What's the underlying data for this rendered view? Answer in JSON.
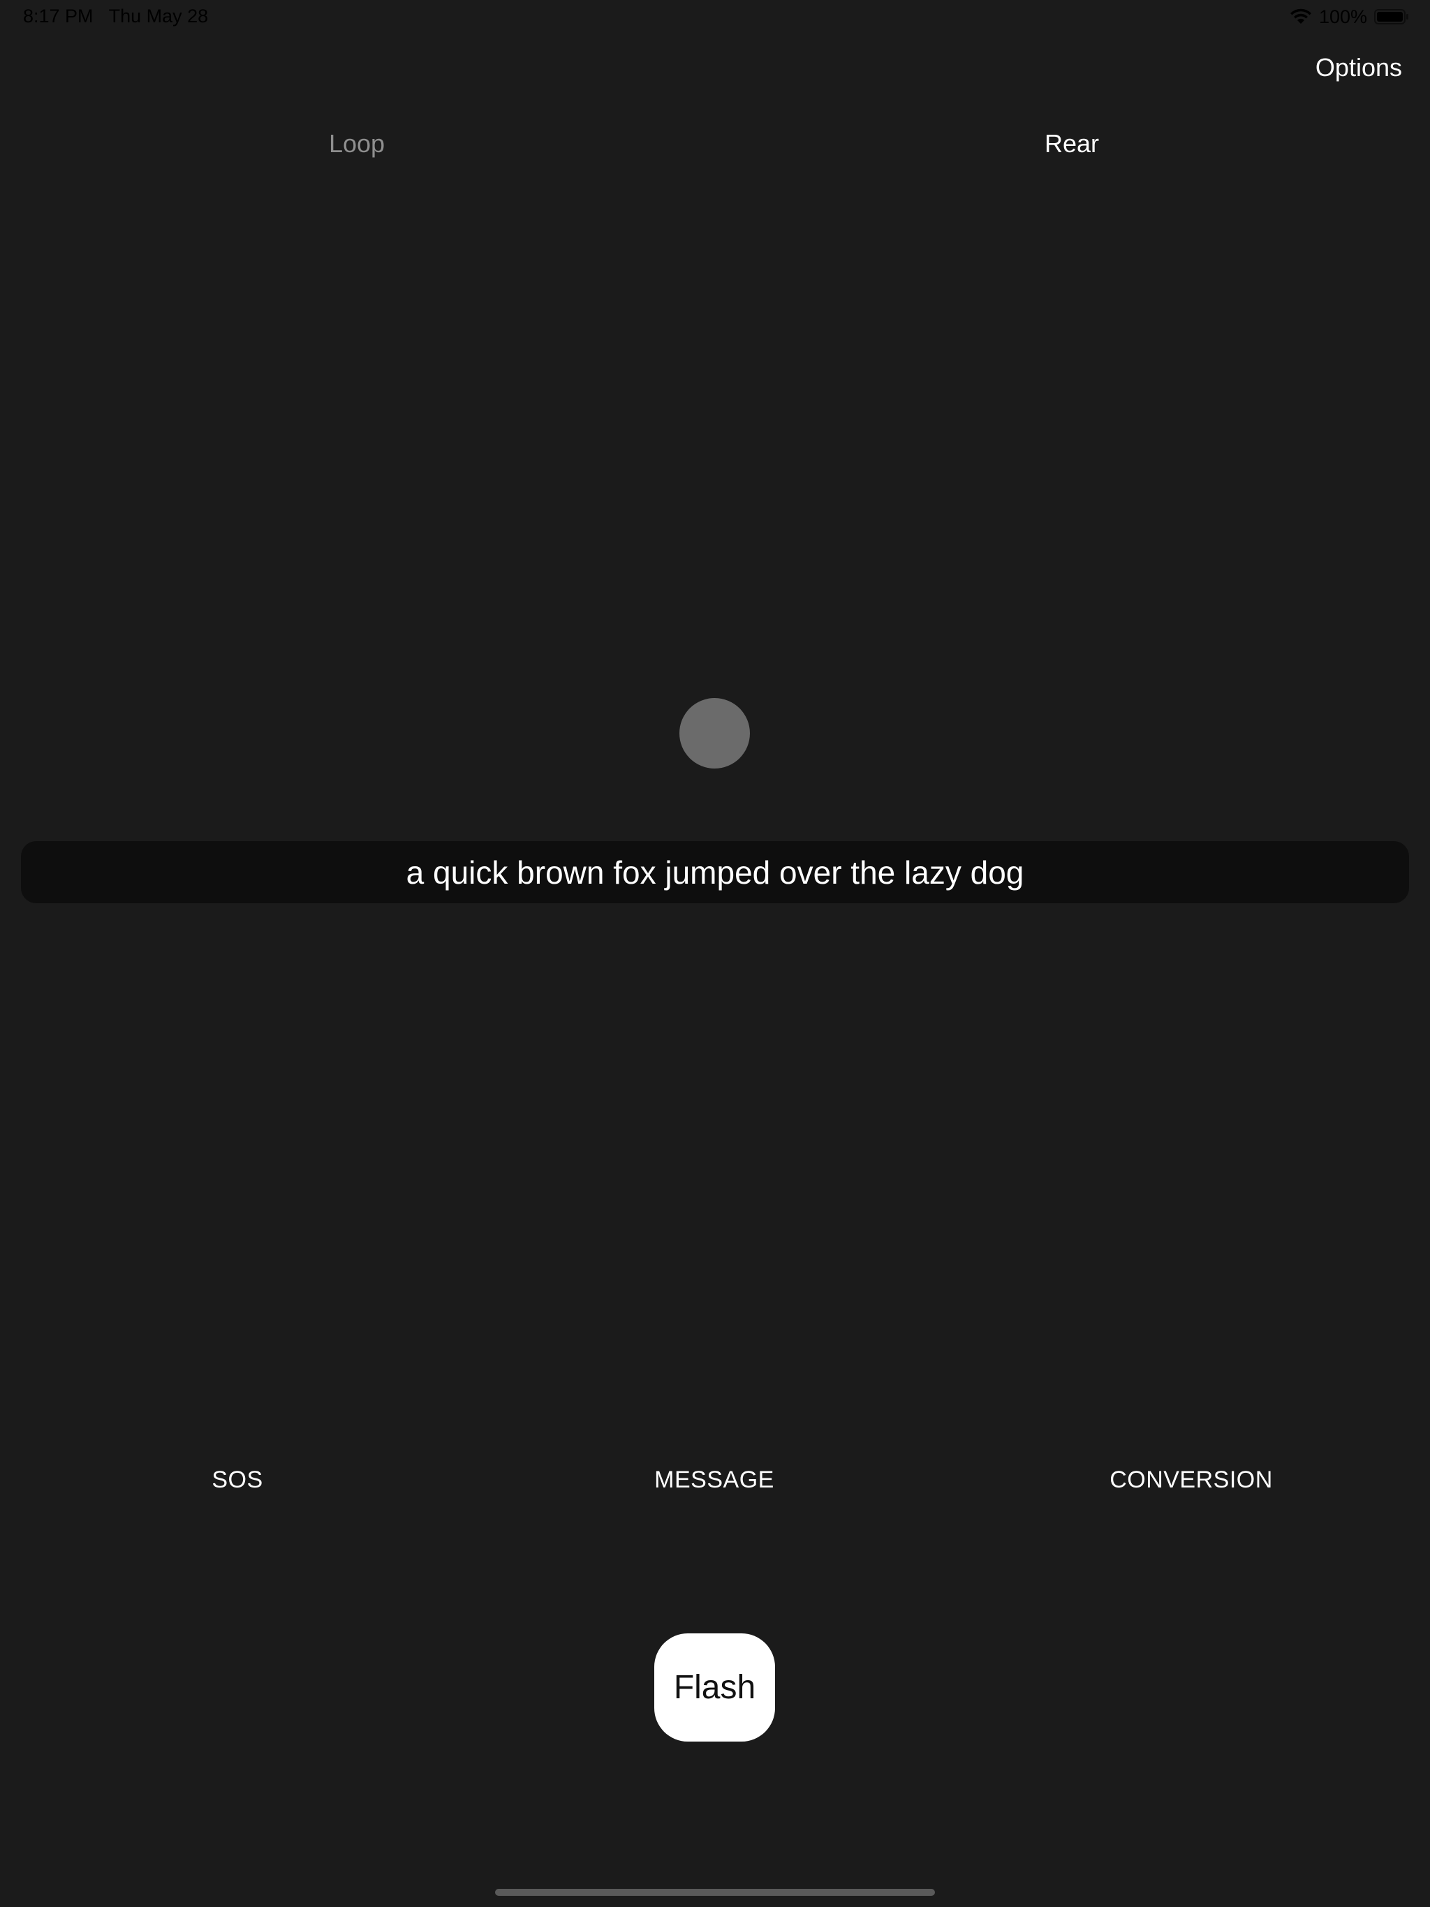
{
  "status_bar": {
    "time": "8:17 PM",
    "date": "Thu May 28",
    "battery_text": "100%",
    "wifi_icon": "wifi-icon",
    "battery_icon": "battery-icon"
  },
  "header": {
    "options_label": "Options"
  },
  "toggles": {
    "loop_label": "Loop",
    "rear_label": "Rear"
  },
  "message": {
    "text": "a quick brown fox jumped over the lazy dog"
  },
  "modes": {
    "sos_label": "SOS",
    "message_label": "MESSAGE",
    "conversion_label": "CONVERSION"
  },
  "flash": {
    "label": "Flash"
  },
  "colors": {
    "background": "#1b1b1b",
    "message_box": "#0e0e0e",
    "indicator": "#6b6b6b",
    "inactive_text": "#8e8e8e",
    "active_text": "#ffffff"
  }
}
